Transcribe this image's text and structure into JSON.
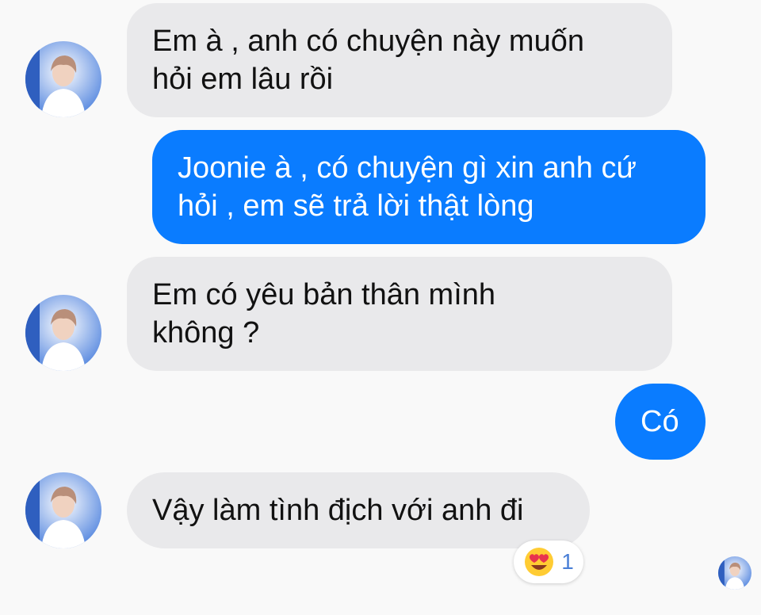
{
  "conversation": {
    "messages": [
      {
        "sender": "other",
        "text": "Em à , anh có chuyện này muốn\nhỏi em lâu rồi"
      },
      {
        "sender": "self",
        "text": "Joonie à , có chuyện gì xin anh cứ\nhỏi , em sẽ trả lời thật lòng"
      },
      {
        "sender": "other",
        "text": "Em có yêu bản thân mình\nkhông ?"
      },
      {
        "sender": "self",
        "text": "Có"
      },
      {
        "sender": "other",
        "text": "Vậy làm tình địch với anh đi"
      }
    ],
    "reaction": {
      "emoji": "heart-eyes-emoji",
      "count": "1"
    }
  },
  "colors": {
    "incoming_bubble": "#e9e9eb",
    "outgoing_bubble": "#0a7cff",
    "background": "#f9f9f9",
    "reaction_count": "#4a7fd6"
  },
  "icons": {
    "avatar": "profile-photo-icon",
    "reaction": "heart-eyes-emoji"
  }
}
